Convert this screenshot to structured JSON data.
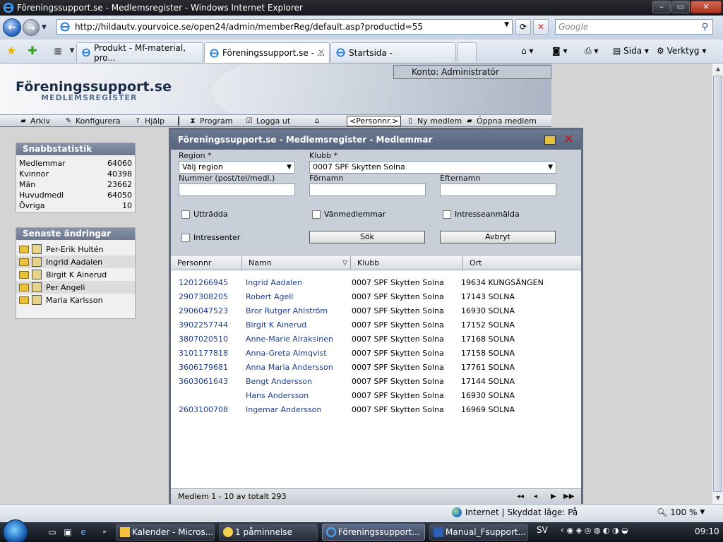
{
  "window": {
    "title": "Föreningssupport.se - Medlemsregister - Windows Internet Explorer",
    "url": "http://hildautv.yourvoice.se/open24/admin/memberReg/default.asp?productid=55",
    "search_placeholder": "Google"
  },
  "tabs": [
    {
      "label": "Produkt - Mf-material, pro..."
    },
    {
      "label": "Föreningssupport.se - ..."
    },
    {
      "label": "Startsida -"
    }
  ],
  "commands": {
    "page": "Sida",
    "tools": "Verktyg"
  },
  "site": {
    "brand": "Föreningssupport.se",
    "subtitle": "MEDLEMSREGISTER",
    "account": "Konto: Administratör"
  },
  "menu": {
    "arkiv": "Arkiv",
    "konfigurera": "Konfigurera",
    "hjalp": "Hjälp",
    "program": "Program",
    "logga_ut": "Logga ut",
    "personnr": "<Personnr.>",
    "ny_medlem": "Ny medlem",
    "oppna_medlem": "Öppna medlem"
  },
  "stats": {
    "title": "Snabbstatistik",
    "rows": [
      {
        "label": "Medlemmar",
        "value": "64060"
      },
      {
        "label": "Kvinnor",
        "value": "40398"
      },
      {
        "label": "Män",
        "value": "23662"
      },
      {
        "label": "Huvudmedl",
        "value": "64050"
      },
      {
        "label": "Övriga",
        "value": "10"
      }
    ]
  },
  "recent": {
    "title": "Senaste ändringar",
    "items": [
      "Per-Erik Hultén",
      "Ingrid Aadalen",
      "Birgit K Ainerud",
      "Per Angeli",
      "Maria Karlsson"
    ]
  },
  "modal": {
    "title": "Föreningssupport.se - Medlemsregister - Medlemmar",
    "region_label": "Region *",
    "region_value": "Välj region",
    "klubb_label": "Klubb *",
    "klubb_value": "0007 SPF Skytten Solna",
    "nummer_label": "Nummer (post/tel/medl.)",
    "fornamn_label": "Förnamn",
    "efternamn_label": "Efternamn",
    "chk_uttradda": "Utträdda",
    "chk_vanmedlemmar": "Vänmedlemmar",
    "chk_intresseanmalda": "Intresseanmälda",
    "chk_intressenter": "Intressenter",
    "btn_sok": "Sök",
    "btn_avbryt": "Avbryt",
    "columns": [
      "Personnr",
      "Namn",
      "Klubb",
      "Ort"
    ],
    "rows": [
      {
        "personnr": "1201266945",
        "namn": "Ingrid Aadalen",
        "klubb": "0007 SPF Skytten Solna",
        "ort": "19634 KUNGSÄNGEN"
      },
      {
        "personnr": "2907308205",
        "namn": "Robert Agell",
        "klubb": "0007 SPF Skytten Solna",
        "ort": "17143 SOLNA"
      },
      {
        "personnr": "2906047523",
        "namn": "Bror Rutger Ahlström",
        "klubb": "0007 SPF Skytten Solna",
        "ort": "16930 SOLNA"
      },
      {
        "personnr": "3902257744",
        "namn": "Birgit K Ainerud",
        "klubb": "0007 SPF Skytten Solna",
        "ort": "17152 SOLNA"
      },
      {
        "personnr": "3807020510",
        "namn": "Anne-Marie Airaksinen",
        "klubb": "0007 SPF Skytten Solna",
        "ort": "17168 SOLNA"
      },
      {
        "personnr": "3101177818",
        "namn": "Anna-Greta Almqvist",
        "klubb": "0007 SPF Skytten Solna",
        "ort": "17158 SOLNA"
      },
      {
        "personnr": "3606179681",
        "namn": "Anna Maria Andersson",
        "klubb": "0007 SPF Skytten Solna",
        "ort": "17761 SOLNA"
      },
      {
        "personnr": "3603061643",
        "namn": "Bengt Andersson",
        "klubb": "0007 SPF Skytten Solna",
        "ort": "17144 SOLNA"
      },
      {
        "personnr": "",
        "namn": "Hans Andersson",
        "klubb": "0007 SPF Skytten Solna",
        "ort": "16930 SOLNA"
      },
      {
        "personnr": "2603100708",
        "namn": "Ingemar Andersson",
        "klubb": "0007 SPF Skytten Solna",
        "ort": "16969 SOLNA"
      }
    ],
    "footer": "Medlem 1 - 10 av totalt 293"
  },
  "status": {
    "zone": "Internet | Skyddat läge: På",
    "zoom": "100 %"
  },
  "taskbar": {
    "buttons": [
      "Kalender - Micros...",
      "1 påminnelse",
      "Föreningssupport...",
      "Manual_Fsupport..."
    ],
    "lang": "SV",
    "clock": "09:10"
  },
  "icons": {
    "back": "back-arrow-icon",
    "forward": "forward-arrow-icon",
    "refresh": "refresh-icon",
    "stop": "stop-icon",
    "search": "search-icon",
    "favorites": "star-icon",
    "home": "home-icon",
    "close_modal": "close-icon"
  }
}
